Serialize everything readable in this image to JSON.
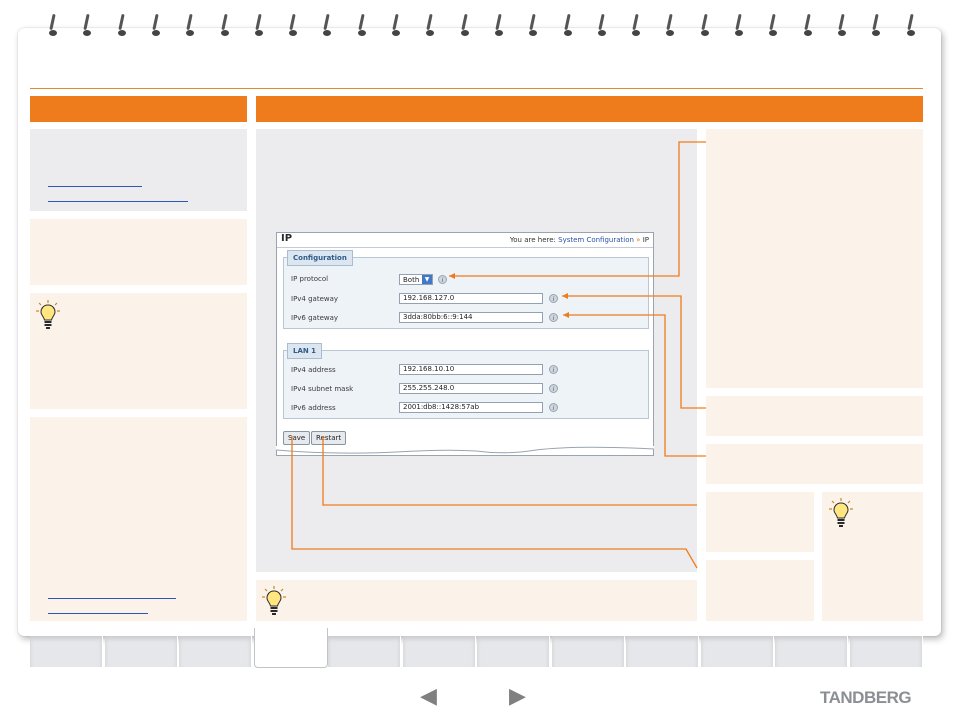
{
  "screenshot": {
    "title": "IP",
    "breadcrumb_prefix": "You are here:",
    "breadcrumb_link": "System Configuration",
    "breadcrumb_sep": "»",
    "breadcrumb_current": "IP",
    "configuration": {
      "group_label": "Configuration",
      "ip_protocol_label": "IP protocol",
      "ip_protocol_value": "Both",
      "ipv4_gateway_label": "IPv4 gateway",
      "ipv4_gateway_value": "192.168.127.0",
      "ipv6_gateway_label": "IPv6 gateway",
      "ipv6_gateway_value": "3dda:80bb:6::9:144"
    },
    "lan1": {
      "group_label": "LAN 1",
      "ipv4_address_label": "IPv4 address",
      "ipv4_address_value": "192.168.10.10",
      "ipv4_subnet_label": "IPv4 subnet mask",
      "ipv4_subnet_value": "255.255.248.0",
      "ipv6_address_label": "IPv6 address",
      "ipv6_address_value": "2001:db8::1428:57ab"
    },
    "save_label": "Save",
    "restart_label": "Restart"
  },
  "footer": {
    "prev_arrow": "◀",
    "next_arrow": "▶",
    "brand": "TANDBERG"
  },
  "colors": {
    "accent": "#ef7c1c",
    "grey_panel": "#ececee",
    "cream_panel": "#fbf3ea",
    "link": "#2e55b8"
  },
  "icons": {
    "bulb": "lightbulb-icon",
    "info": "info-icon",
    "prev": "left-arrow-icon",
    "next": "right-arrow-icon"
  }
}
